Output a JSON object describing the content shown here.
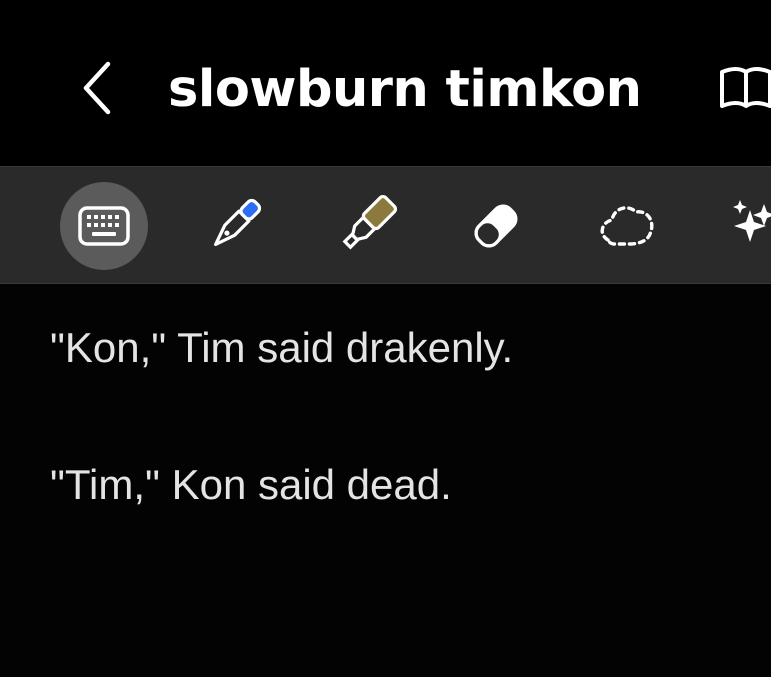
{
  "header": {
    "back_icon": "chevron-left-icon",
    "title": "slowburn timkon",
    "reading_mode_icon": "open-book-icon"
  },
  "toolbar": {
    "tools": [
      {
        "name": "keyboard",
        "icon": "keyboard-icon",
        "active": true
      },
      {
        "name": "pen",
        "icon": "pen-icon",
        "color": "#2f6df5"
      },
      {
        "name": "highlighter",
        "icon": "highlighter-icon",
        "color": "#8c7a3c"
      },
      {
        "name": "eraser",
        "icon": "eraser-icon"
      },
      {
        "name": "lasso",
        "icon": "lasso-select-icon"
      },
      {
        "name": "ai-assist",
        "icon": "sparkle-icon"
      }
    ]
  },
  "note": {
    "lines": [
      "\"Kon,\" Tim said drakenly.",
      "\"Tim,\" Kon said dead."
    ]
  },
  "colors": {
    "background": "#030303",
    "toolbar": "#2a2a2a",
    "active_tool": "#5b5b5b",
    "text": "#e4e4e4"
  }
}
